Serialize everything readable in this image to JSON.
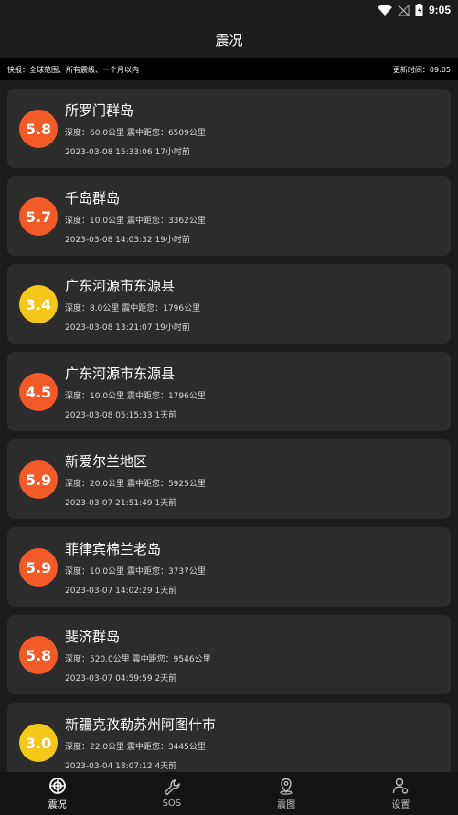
{
  "status_bar": {
    "time": "9:05"
  },
  "header": {
    "title": "震况"
  },
  "info_bar": {
    "left_text": "快报：全球范围、所有震级、一个月以内",
    "right_text": "更新时间：09:05"
  },
  "events": [
    {
      "magnitude": "5.8",
      "level": "red",
      "place": "所罗门群岛",
      "depth_label": "深度：",
      "depth": "60.0公里",
      "distance_label": "震中距您：",
      "distance": "6509公里",
      "datetime": "2023-03-08 15:33:06",
      "ago": "17小时前"
    },
    {
      "magnitude": "5.7",
      "level": "red",
      "place": "千岛群岛",
      "depth_label": "深度：",
      "depth": "10.0公里",
      "distance_label": "震中距您：",
      "distance": "3362公里",
      "datetime": "2023-03-08 14:03:32",
      "ago": "19小时前"
    },
    {
      "magnitude": "3.4",
      "level": "yellow",
      "place": "广东河源市东源县",
      "depth_label": "深度：",
      "depth": "8.0公里",
      "distance_label": "震中距您：",
      "distance": "1796公里",
      "datetime": "2023-03-08 13:21:07",
      "ago": "19小时前"
    },
    {
      "magnitude": "4.5",
      "level": "red",
      "place": "广东河源市东源县",
      "depth_label": "深度：",
      "depth": "10.0公里",
      "distance_label": "震中距您：",
      "distance": "1796公里",
      "datetime": "2023-03-08 05:15:33",
      "ago": "1天前"
    },
    {
      "magnitude": "5.9",
      "level": "red",
      "place": "新爱尔兰地区",
      "depth_label": "深度：",
      "depth": "20.0公里",
      "distance_label": "震中距您：",
      "distance": "5925公里",
      "datetime": "2023-03-07 21:51:49",
      "ago": "1天前"
    },
    {
      "magnitude": "5.9",
      "level": "red",
      "place": "菲律宾棉兰老岛",
      "depth_label": "深度：",
      "depth": "10.0公里",
      "distance_label": "震中距您：",
      "distance": "3737公里",
      "datetime": "2023-03-07 14:02:29",
      "ago": "1天前"
    },
    {
      "magnitude": "5.8",
      "level": "red",
      "place": "斐济群岛",
      "depth_label": "深度：",
      "depth": "520.0公里",
      "distance_label": "震中距您：",
      "distance": "9546公里",
      "datetime": "2023-03-07 04:59:59",
      "ago": "2天前"
    },
    {
      "magnitude": "3.0",
      "level": "yellow",
      "place": "新疆克孜勒苏州阿图什市",
      "depth_label": "深度：",
      "depth": "22.0公里",
      "distance_label": "震中距您：",
      "distance": "3445公里",
      "datetime": "2023-03-04 18:07:12",
      "ago": "4天前"
    }
  ],
  "nav": [
    {
      "label": "震况",
      "icon": "target-icon",
      "active": true
    },
    {
      "label": "SOS",
      "icon": "wrench-icon",
      "active": false
    },
    {
      "label": "震图",
      "icon": "map-pin-icon",
      "active": false
    },
    {
      "label": "设置",
      "icon": "user-gear-icon",
      "active": false
    }
  ],
  "colors": {
    "red": "#f25a28",
    "yellow": "#f5c718",
    "card": "#2c2c2c",
    "background": "#1c1c1c"
  }
}
